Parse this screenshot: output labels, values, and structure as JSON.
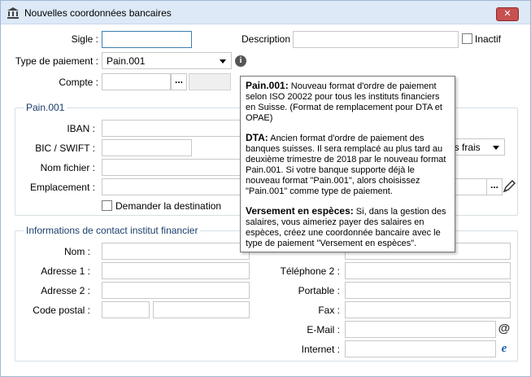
{
  "window": {
    "title": "Nouvelles coordonnées bancaires",
    "close_label": "✕"
  },
  "top": {
    "sigle_label": "Sigle :",
    "sigle_value": "",
    "description_label": "Description :",
    "description_value": "",
    "inactif_label": "Inactif",
    "type_label": "Type de paiement :",
    "type_value": "Pain.001",
    "compte_label": "Compte :",
    "compte_value": "",
    "ellipsis": "..."
  },
  "pain": {
    "group_title": "Pain.001",
    "iban_label": "IBAN :",
    "iban_value": "",
    "bic_label": "BIC / SWIFT :",
    "bic_value": "",
    "nom_fichier_label": "Nom fichier :",
    "nom_fichier_value": "",
    "emplacement_label": "Emplacement :",
    "emplacement_value": "",
    "frais_value": "es frais",
    "demander_label": "Demander la destination",
    "ellipsis": "..."
  },
  "contact": {
    "group_title": "Informations de contact institut financier",
    "nom_label": "Nom :",
    "adresse1_label": "Adresse 1 :",
    "adresse2_label": "Adresse 2 :",
    "code_postal_label": "Code postal :",
    "telephone2_label": "Téléphone 2 :",
    "portable_label": "Portable :",
    "fax_label": "Fax :",
    "email_label": "E-Mail :",
    "internet_label": "Internet :"
  },
  "tooltip": {
    "p1_title": "Pain.001:",
    "p1_text": " Nouveau format d'ordre de paiement selon ISO 20022 pour tous les instituts financiers en Suisse. (Format de remplacement pour DTA et OPAE)",
    "p2_title": "DTA:",
    "p2_text": " Ancien format d'ordre de paiement des banques suisses. Il sera remplacé au plus tard au deuxième trimestre de 2018 par le nouveau format Pain.001. Si votre banque supporte déjà le nouveau format \"Pain.001\", alors choisissez \"Pain.001\" comme type de paiement.",
    "p3_title": "Versement en espèces:",
    "p3_text": " Si, dans la gestion des salaires, vous aimeriez payer des salaires en espèces, créez une coordonnée bancaire avec le type de paiement \"Versement en espèces\"."
  }
}
